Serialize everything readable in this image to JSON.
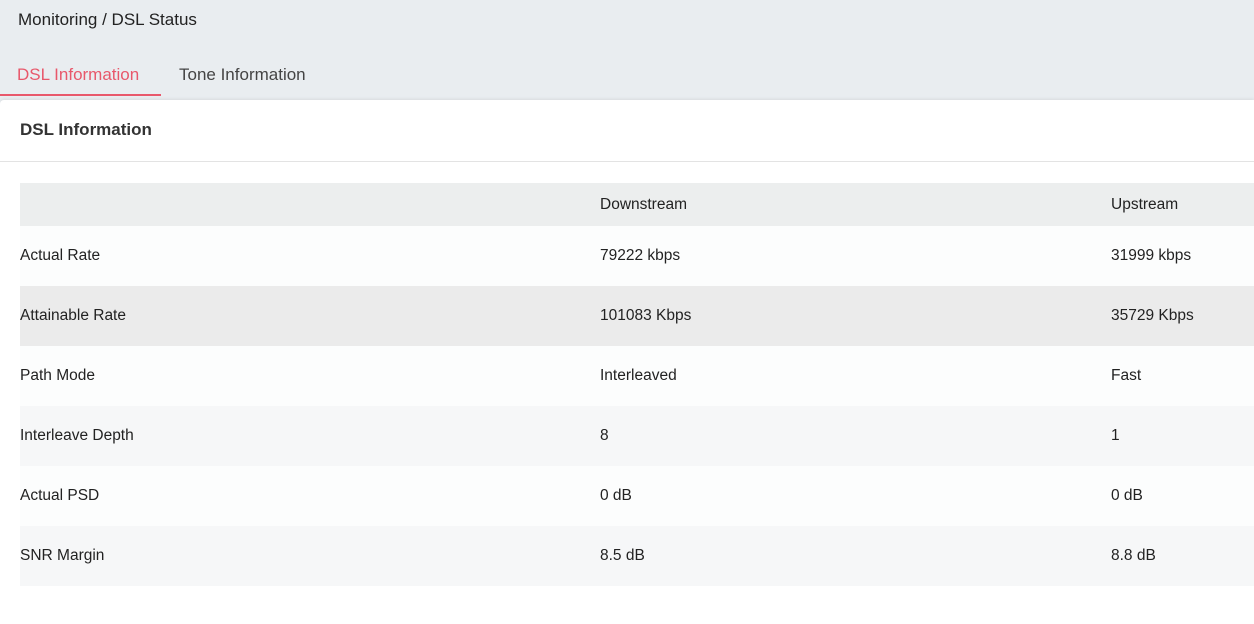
{
  "breadcrumb": "Monitoring / DSL Status",
  "tabs": [
    {
      "label": "DSL Information",
      "active": true
    },
    {
      "label": "Tone Information",
      "active": false
    }
  ],
  "panel": {
    "title": "DSL Information"
  },
  "table": {
    "headers": [
      "",
      "Downstream",
      "Upstream"
    ],
    "rows": [
      {
        "label": "Actual Rate",
        "downstream": "79222 kbps",
        "upstream": "31999 kbps"
      },
      {
        "label": "Attainable Rate",
        "downstream": "101083 Kbps",
        "upstream": "35729 Kbps"
      },
      {
        "label": "Path Mode",
        "downstream": "Interleaved",
        "upstream": "Fast"
      },
      {
        "label": "Interleave Depth",
        "downstream": "8",
        "upstream": "1"
      },
      {
        "label": "Actual PSD",
        "downstream": "0 dB",
        "upstream": "0 dB"
      },
      {
        "label": "SNR Margin",
        "downstream": "8.5 dB",
        "upstream": "8.8 dB"
      }
    ]
  },
  "colors": {
    "accent": "#e8586b",
    "header_bg": "#e9edf0",
    "table_header_bg": "#eceeee",
    "row_highlight_bg": "#ebebeb"
  }
}
